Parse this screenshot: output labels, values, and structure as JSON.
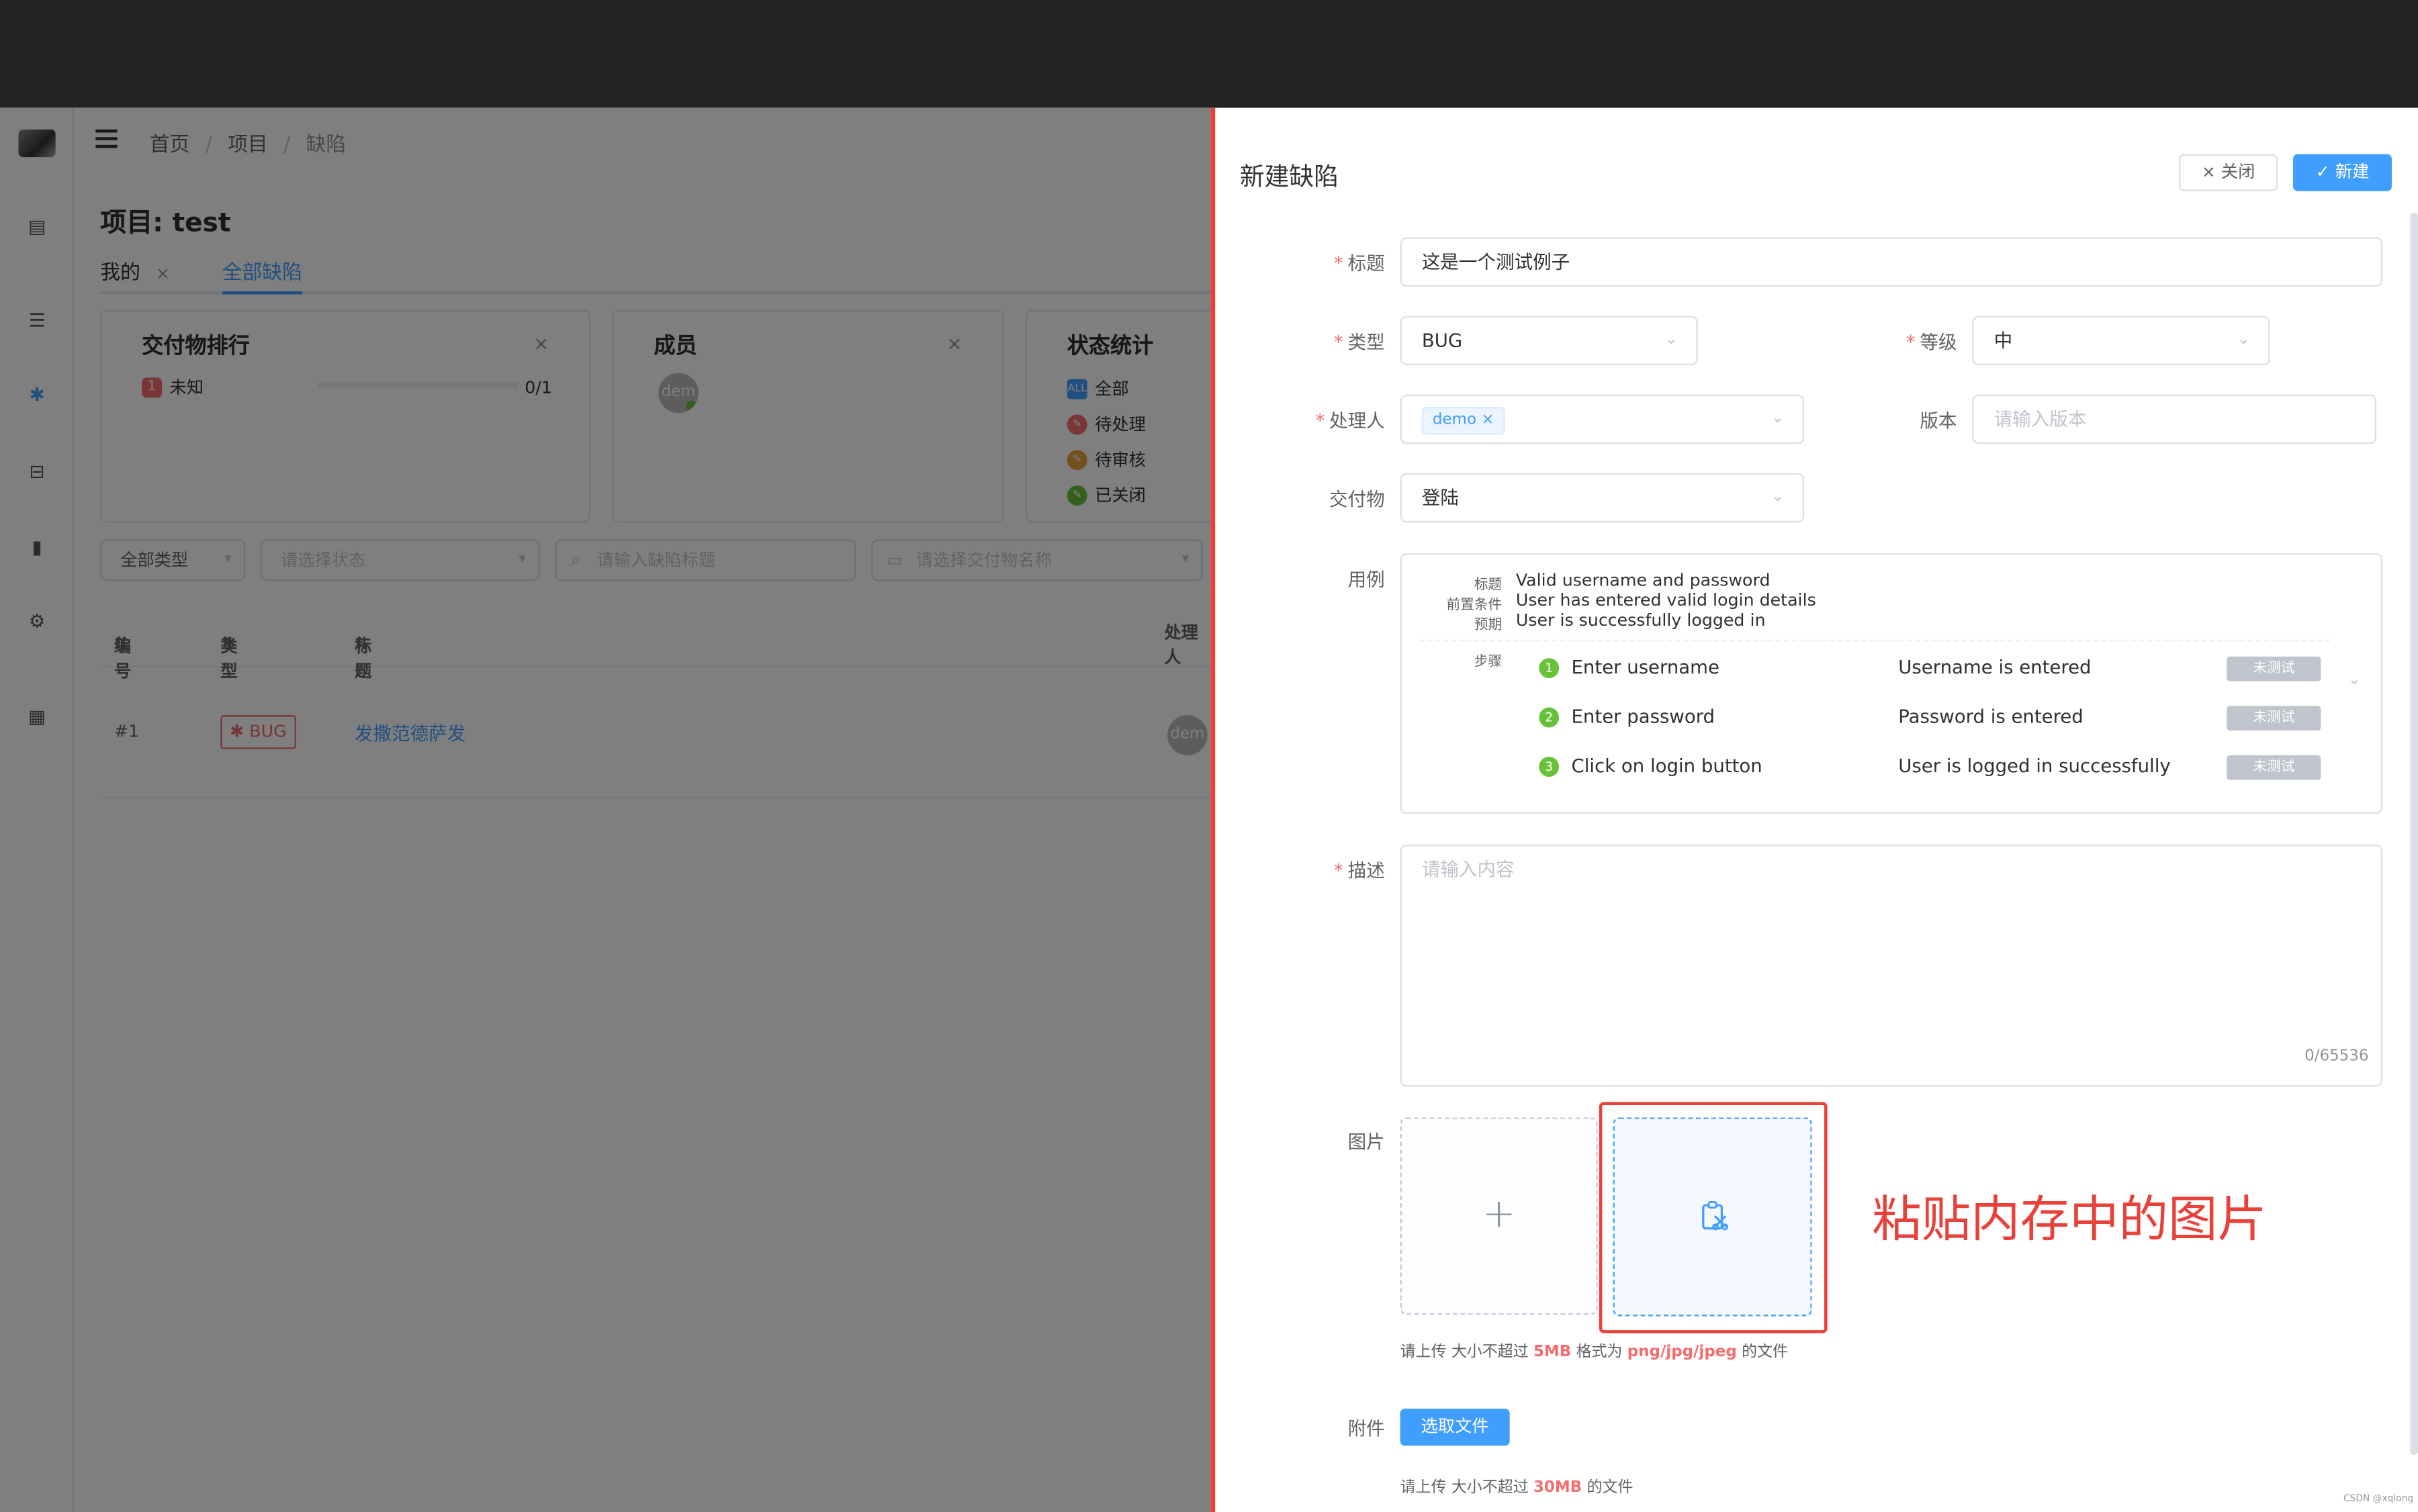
{
  "breadcrumb": {
    "home": "首页",
    "project": "项目",
    "current": "缺陷",
    "sep": "/"
  },
  "page": {
    "title": "项目: test"
  },
  "tabs": [
    {
      "label": "我的",
      "close": "×"
    },
    {
      "label": "全部缺陷"
    }
  ],
  "cards": {
    "delivery": {
      "title": "交付物排行",
      "close": "×",
      "rank_no": "1",
      "item": "未知",
      "count": "0/1",
      "progress": 0
    },
    "members": {
      "title": "成员",
      "close": "×",
      "avatar": "dem"
    },
    "status": {
      "title": "状态统计",
      "all_icon": "ALL",
      "items": [
        "全部",
        "待处理",
        "待审核",
        "已关闭"
      ],
      "colors": [
        "#409eff",
        "#f56c6c",
        "#e6a23c",
        "#67c23a"
      ]
    }
  },
  "filters": {
    "type": "全部类型",
    "status_ph": "请选择状态",
    "title_ph": "请输入缺陷标题",
    "deliver_ph": "请选择交付物名称"
  },
  "table": {
    "headers": [
      "编号",
      "类型",
      "标题",
      "处理人"
    ],
    "row": {
      "id": "#1",
      "type": "BUG",
      "title": "发撒范德萨发",
      "assignee": "dem"
    }
  },
  "drawer": {
    "title": "新建缺陷",
    "close_label": "关闭",
    "new_label": "新建",
    "form": {
      "title_label": "标题",
      "title_value": "这是一个测试例子",
      "type_label": "类型",
      "type_value": "BUG",
      "level_label": "等级",
      "level_value": "中",
      "assignee_label": "处理人",
      "assignee_chip": "demo",
      "version_label": "版本",
      "version_ph": "请输入版本",
      "deliverable_label": "交付物",
      "deliverable_value": "登陆",
      "case_label": "用例",
      "case": {
        "title_k": "标题",
        "title_v": "Valid username and password",
        "pre_k": "前置条件",
        "pre_v": "User has entered valid login details",
        "expect_k": "预期",
        "expect_v": "User is successfully logged in",
        "steps_k": "步骤",
        "steps": [
          {
            "n": "1",
            "action": "Enter username",
            "result": "Username is entered",
            "status": "未测试"
          },
          {
            "n": "2",
            "action": "Enter password",
            "result": "Password is entered",
            "status": "未测试"
          },
          {
            "n": "3",
            "action": "Click on login button",
            "result": "User is logged in successfully",
            "status": "未测试"
          }
        ]
      },
      "desc_label": "描述",
      "desc_ph": "请输入内容",
      "desc_count": "0/65536",
      "image_label": "图片",
      "plus": "+",
      "image_tip_a": "请上传 大小不超过 ",
      "image_tip_size": "5MB",
      "image_tip_b": " 格式为 ",
      "image_tip_fmt": "png/jpg/jpeg",
      "image_tip_c": " 的文件",
      "annotation": "粘贴内存中的图片",
      "attach_label": "附件",
      "attach_btn": "选取文件",
      "attach_tip_a": "请上传 大小不超过 ",
      "attach_tip_size": "30MB",
      "attach_tip_b": " 的文件"
    }
  },
  "watermark": "CSDN @xqlong"
}
